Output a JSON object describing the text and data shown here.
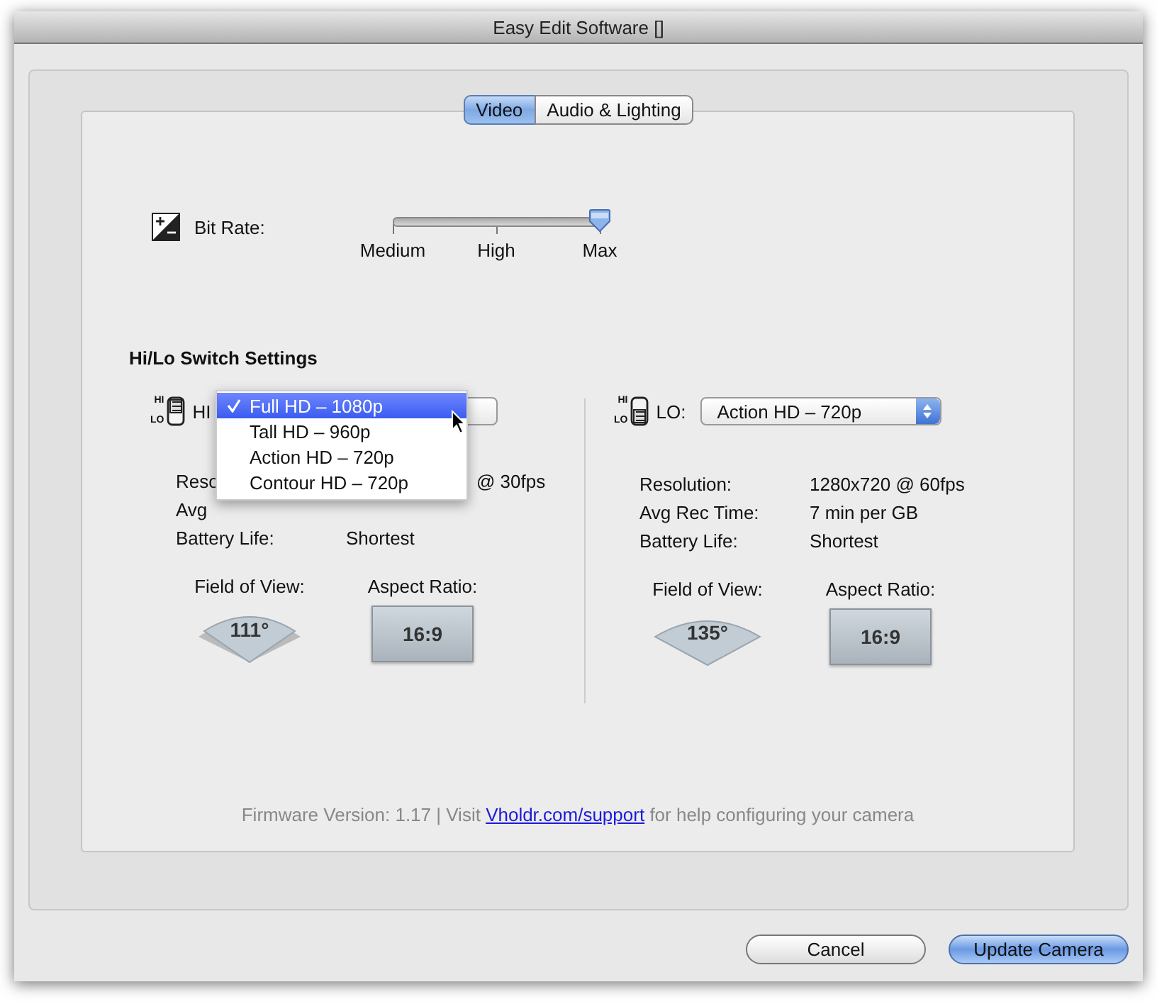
{
  "window": {
    "title": "Easy Edit Software []"
  },
  "tabs": [
    {
      "label": "Video",
      "selected": true
    },
    {
      "label": "Audio & Lighting",
      "selected": false
    }
  ],
  "bit_rate": {
    "label": "Bit Rate:",
    "level": 1,
    "ticks": [
      "Medium",
      "High",
      "Max"
    ]
  },
  "section_title": "Hi/Lo Switch Settings",
  "switches": [
    {
      "switch": {
        "top": "HI",
        "bottom": "LO",
        "high": true
      },
      "label": "HI",
      "details": [
        {
          "label": "Reso",
          "value": "@ 30fps",
          "covered": true
        },
        {
          "label": "Avg",
          "covered": true
        },
        {
          "label": "Battery Life:",
          "value": "Shortest",
          "covered": false
        }
      ],
      "fov_label": "Field of View:",
      "fov": "111°",
      "aspect_label": "Aspect Ratio:",
      "aspect": "16:9",
      "menu": [
        {
          "label": "Full HD – 1080p",
          "selected": true
        },
        {
          "label": "Tall HD – 960p",
          "selected": false
        },
        {
          "label": "Action HD – 720p",
          "selected": false
        },
        {
          "label": "Contour HD – 720p",
          "selected": false
        }
      ]
    },
    {
      "switch": {
        "top": "HI",
        "bottom": "LO",
        "high": false
      },
      "label": "LO:",
      "select": "Action HD – 720p",
      "details": [
        {
          "label": "Resolution:",
          "value": "1280x720 @ 60fps",
          "covered": false
        },
        {
          "label": "Avg Rec Time:",
          "value": "7 min per GB",
          "covered": false
        },
        {
          "label": "Battery Life:",
          "value": "Shortest",
          "covered": false
        }
      ],
      "fov_label": "Field of View:",
      "fov": "135°",
      "aspect_label": "Aspect Ratio:",
      "aspect": "16:9"
    }
  ],
  "footer": {
    "before": "Firmware Version: 1.17 | Visit ",
    "link": "Vholdr.com/support",
    "after": " for help configuring your camera"
  },
  "buttons": [
    {
      "label": "Cancel",
      "default": false
    },
    {
      "label": "Update Camera",
      "default": true
    }
  ]
}
